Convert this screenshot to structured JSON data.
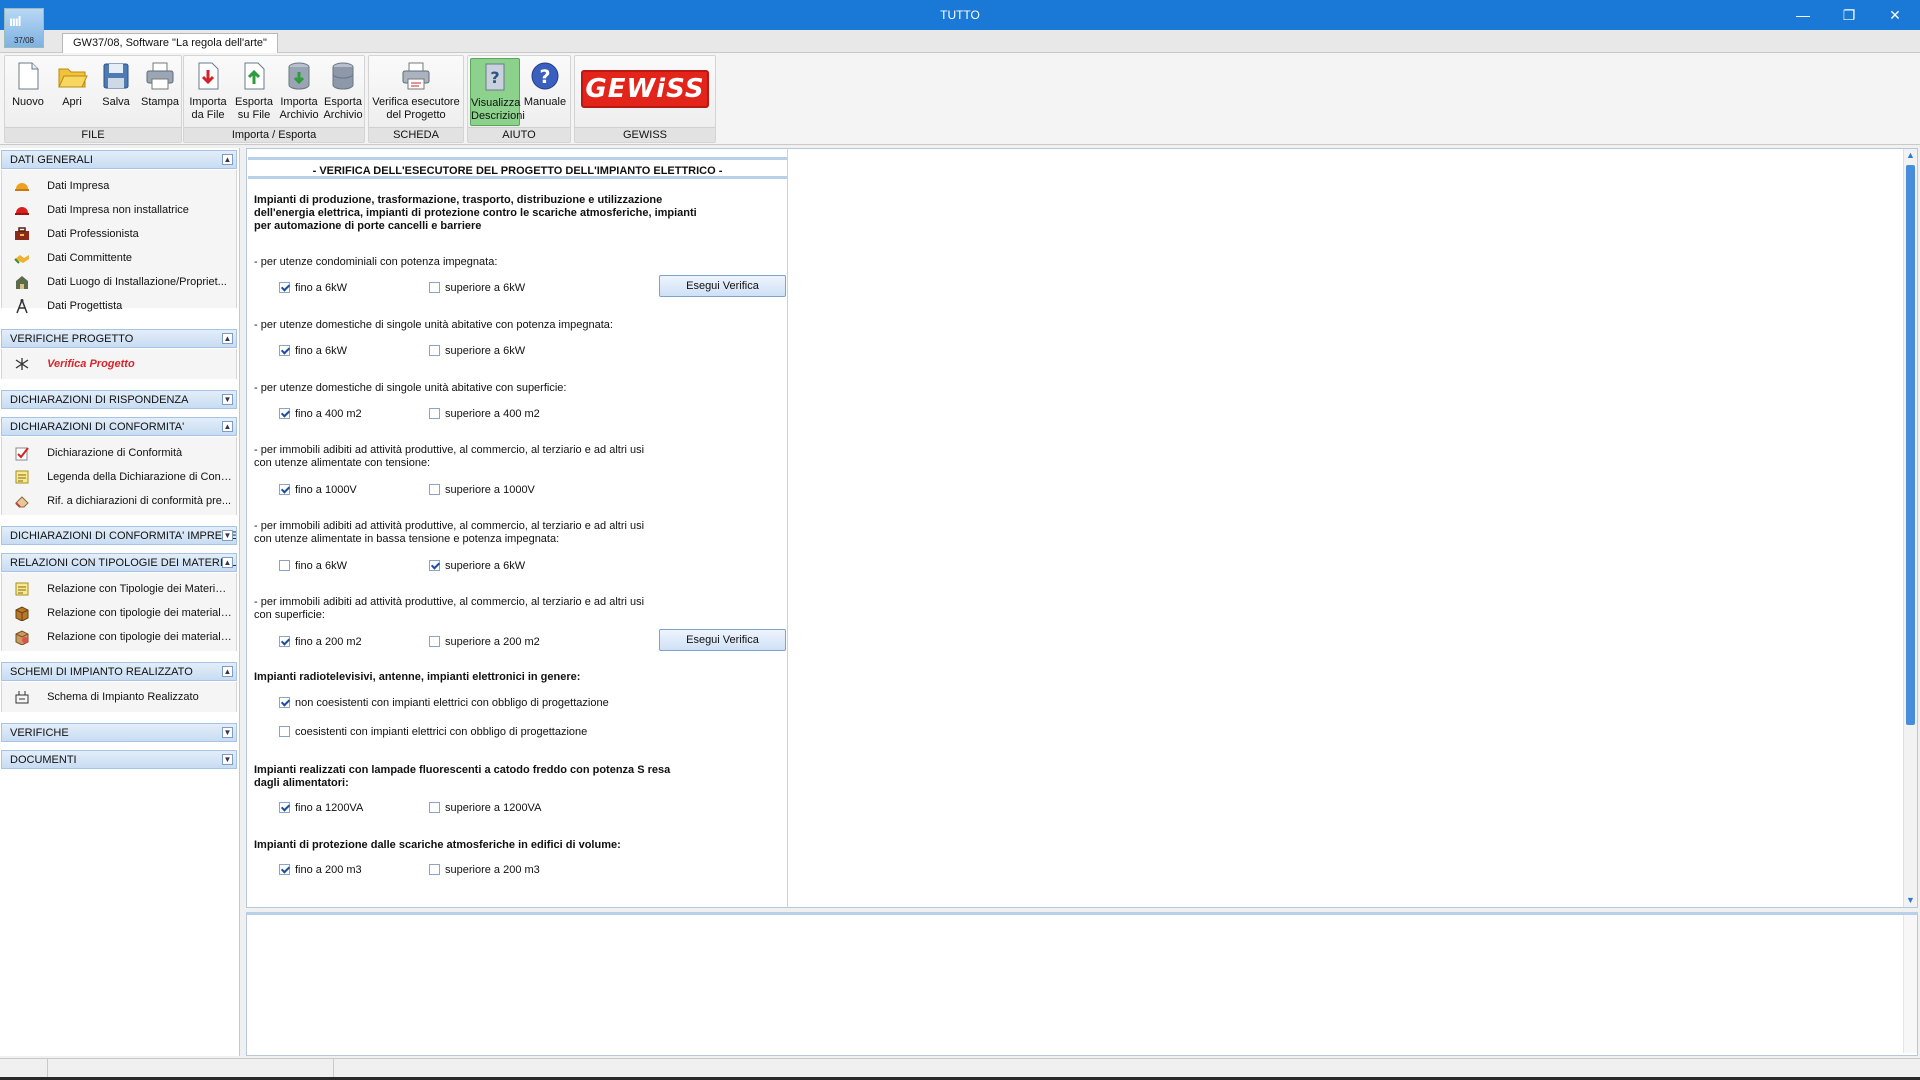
{
  "window": {
    "title": "TUTTO",
    "logo_code": "37/08",
    "logo_glyph": "ıııl"
  },
  "tab": {
    "label": "GW37/08, Software \"La regola dell'arte\""
  },
  "ribbon": {
    "file": {
      "label": "FILE",
      "nuovo": "Nuovo",
      "apri": "Apri",
      "salva": "Salva",
      "stampa": "Stampa"
    },
    "import_export": {
      "label": "Importa / Esporta",
      "importa_file": "Importa da File",
      "esporta_file": "Esporta su File",
      "importa_archivio": "Importa Archivio",
      "esporta_archivio": "Esporta Archivio"
    },
    "scheda": {
      "label": "SCHEDA",
      "verifica": "Verifica esecutore del Progetto"
    },
    "aiuto": {
      "label": "AIUTO",
      "visualizza": "Visualizza Descrizioni",
      "manuale": "Manuale"
    },
    "gewiss": {
      "label": "GEWISS",
      "logo": "GEWiSS"
    }
  },
  "sidebar": {
    "dati_generali": {
      "header": "DATI GENERALI",
      "items": [
        "Dati Impresa",
        "Dati Impresa non installatrice",
        "Dati Professionista",
        "Dati Committente",
        "Dati Luogo di Installazione/Propriet...",
        "Dati Progettista"
      ]
    },
    "verifiche_progetto": {
      "header": "VERIFICHE PROGETTO",
      "items": [
        "Verifica Progetto"
      ]
    },
    "dich_rispondenza": {
      "header": "DICHIARAZIONI DI RISPONDENZA"
    },
    "dich_conformita": {
      "header": "DICHIARAZIONI DI CONFORMITA'",
      "items": [
        "Dichiarazione di Conformità",
        "Legenda della Dichiarazione di Conf...",
        "Rif. a dichiarazioni di conformità pre..."
      ]
    },
    "dich_conformita_imprese": {
      "header": "DICHIARAZIONI DI CONFORMITA' IMPRESE"
    },
    "relazioni": {
      "header": "RELAZIONI CON TIPOLOGIE DEI MATERIALI",
      "items": [
        "Relazione con Tipologie dei Materiali...",
        "Relazione con tipologie dei materiali...",
        "Relazione con tipologie dei materiali..."
      ]
    },
    "schemi": {
      "header": "SCHEMI DI IMPIANTO REALIZZATO",
      "items": [
        "Schema di Impianto Realizzato"
      ]
    },
    "verifiche": {
      "header": "VERIFICHE"
    },
    "documenti": {
      "header": "DOCUMENTI"
    }
  },
  "form": {
    "title": "- VERIFICA DELL'ESECUTORE DEL PROGETTO DELL'IMPIANTO ELETTRICO -",
    "section1": "Impianti di produzione, trasformazione, trasporto, distribuzione e utilizzazione dell'energia elettrica, impianti di protezione contro le scariche atmosferiche, impianti per automazione di porte cancelli e barriere",
    "q1": "- per utenze condominiali con potenza impegnata:",
    "q1_a": "fino a 6kW",
    "q1_b": "superiore a 6kW",
    "q2": "- per utenze domestiche di singole unità abitative con potenza impegnata:",
    "q2_a": "fino a 6kW",
    "q2_b": "superiore a 6kW",
    "q3": "- per utenze domestiche di singole unità abitative con superficie:",
    "q3_a": "fino a 400 m2",
    "q3_b": "superiore a 400 m2",
    "q4": "- per immobili adibiti ad attività produttive, al commercio, al terziario e ad altri usi con utenze alimentate con tensione:",
    "q4_a": "fino a 1000V",
    "q4_b": "superiore a 1000V",
    "q5": "- per immobili adibiti ad attività produttive, al commercio, al terziario e ad altri usi con utenze alimentate in bassa tensione e potenza impegnata:",
    "q5_a": "fino a 6kW",
    "q5_b": "superiore a 6kW",
    "q6": "- per immobili adibiti ad attività produttive, al commercio, al terziario e ad altri usi con superficie:",
    "q6_a": "fino a 200 m2",
    "q6_b": "superiore a 200 m2",
    "section2": "Impianti radiotelevisivi, antenne, impianti elettronici in genere:",
    "s2_a": "non coesistenti con impianti elettrici con obbligo di progettazione",
    "s2_b": "coesistenti con impianti elettrici con obbligo di progettazione",
    "section3": "Impianti realizzati con lampade fluorescenti a catodo freddo con potenza S resa dagli alimentatori:",
    "s3_a": "fino a 1200VA",
    "s3_b": "superiore a 1200VA",
    "section4": "Impianti di protezione dalle scariche atmosferiche in edifici di volume:",
    "s4_a": "fino a 200 m3",
    "s4_b": "superiore a 200 m3",
    "button_label": "Esegui Verifica"
  },
  "checkbox_states": {
    "q1_a": true,
    "q1_b": false,
    "q2_a": true,
    "q2_b": false,
    "q3_a": true,
    "q3_b": false,
    "q4_a": true,
    "q4_b": false,
    "q5_a": false,
    "q5_b": true,
    "q6_a": true,
    "q6_b": false,
    "s2_a": true,
    "s2_b": false,
    "s3_a": true,
    "s3_b": false,
    "s4_a": true,
    "s4_b": false
  },
  "colors": {
    "titlebar": "#1a78d6",
    "accent_red": "#d8242a",
    "active_green": "#8cd28c",
    "gewiss_red": "#e3241b"
  }
}
